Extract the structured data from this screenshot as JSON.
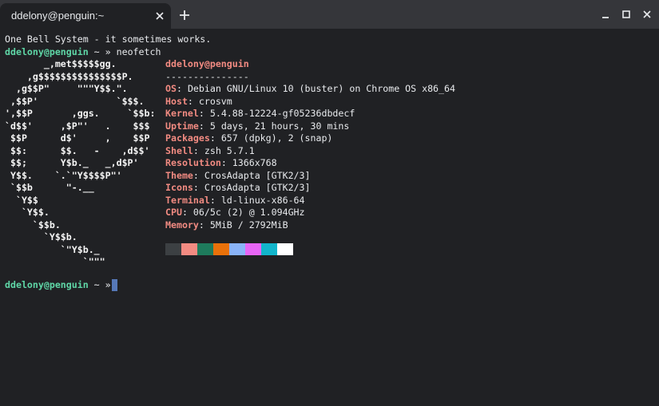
{
  "tab": {
    "title": "ddelony@penguin:~"
  },
  "window": {
    "new_tab": "+"
  },
  "terminal": {
    "motd": "One Bell System - it sometimes works.",
    "prompt1": {
      "user": "ddelony@penguin",
      "rest": " ~ » ",
      "command": "neofetch"
    },
    "ascii": [
      "       _,met$$$$$gg.",
      "    ,g$$$$$$$$$$$$$$$P.",
      "  ,g$$P\"     \"\"\"Y$$.\".",
      " ,$$P'              `$$$.",
      "',$$P       ,ggs.     `$$b:",
      "`d$$'     ,$P\"'   .    $$$",
      " $$P      d$'     ,    $$P",
      " $$:      $$.   -    ,d$$'",
      " $$;      Y$b._   _,d$P'",
      " Y$$.    `.`\"Y$$$$P\"'",
      " `$$b      \"-.__",
      "  `Y$$",
      "   `Y$$.",
      "     `$$b.",
      "       `Y$$b.",
      "          `\"Y$b._",
      "              `\"\"\""
    ],
    "header": "ddelony@penguin",
    "separator": "---------------",
    "info": [
      {
        "key": "OS",
        "value": "Debian GNU/Linux 10 (buster) on Chrome OS x86_64"
      },
      {
        "key": "Host",
        "value": "crosvm"
      },
      {
        "key": "Kernel",
        "value": "5.4.88-12224-gf05236dbdecf"
      },
      {
        "key": "Uptime",
        "value": "5 days, 21 hours, 30 mins"
      },
      {
        "key": "Packages",
        "value": "657 (dpkg), 2 (snap)"
      },
      {
        "key": "Shell",
        "value": "zsh 5.7.1"
      },
      {
        "key": "Resolution",
        "value": "1366x768"
      },
      {
        "key": "Theme",
        "value": "CrosAdapta [GTK2/3]"
      },
      {
        "key": "Icons",
        "value": "CrosAdapta [GTK2/3]"
      },
      {
        "key": "Terminal",
        "value": "ld-linux-x86-64"
      },
      {
        "key": "CPU",
        "value": "06/5c (2) @ 1.094GHz"
      },
      {
        "key": "Memory",
        "value": "5MiB / 2792MiB"
      }
    ],
    "palette": [
      "#3c4043",
      "#f28b82",
      "#1e7b5c",
      "#e8710a",
      "#8ab4f8",
      "#e765f5",
      "#12b5cb",
      "#ffffff"
    ],
    "prompt2": {
      "user": "ddelony@penguin",
      "rest": " ~ » "
    }
  }
}
